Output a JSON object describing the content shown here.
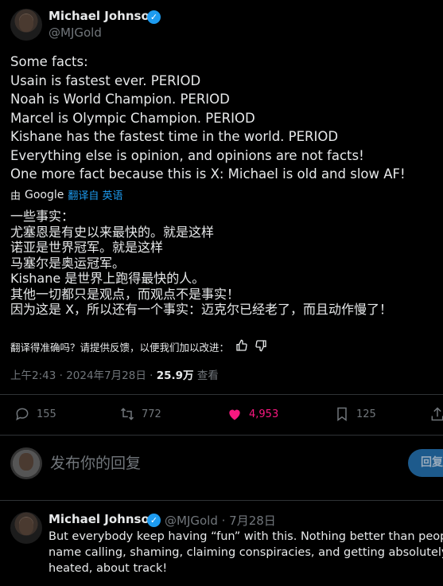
{
  "tweet": {
    "author_name": "Michael Johnson",
    "author_handle": "@MJGold",
    "lines": [
      "Some facts:",
      "Usain is fastest ever. PERIOD",
      "Noah is World Champion. PERIOD",
      "Marcel is Olympic Champion. PERIOD",
      "Kishane has the fastest time in the world. PERIOD",
      "Everything else is opinion, and opinions are not facts!",
      "One more fact because this is X: Michael is old and slow AF!"
    ],
    "translated_by": "由",
    "translated_provider": "Google",
    "translated_from": "翻译自 英语",
    "translation_lines": [
      "一些事实：",
      "尤塞恩是有史以来最快的。就是这样",
      "诺亚是世界冠军。就是这样",
      "马塞尔是奥运冠军。",
      "Kishane 是世界上跑得最快的人。",
      "其他一切都只是观点，而观点不是事实！",
      "因为这是 X，所以还有一个事实：迈克尔已经老了，而且动作慢了！"
    ],
    "feedback_prompt": "翻译得准确吗？请提供反馈，以便我们加以改进：",
    "timestamp": "上午2:43 · 2024年7月28日 ·",
    "views": "25.9万",
    "views_label": "查看",
    "counts": {
      "replies": "155",
      "reposts": "772",
      "likes": "4,953",
      "bookmarks": "125"
    }
  },
  "reply_box": {
    "placeholder": "发布你的回复",
    "button_label": "回复"
  },
  "reply": {
    "author_name": "Michael Johnson",
    "author_handle": "@MJGold",
    "date": "· 7月28日",
    "lines": [
      "But everybody keep having “fun” with this. Nothing better than people",
      "name calling, shaming, claiming conspiracies, and getting absolutely",
      "heated, about track!"
    ]
  },
  "colors": {
    "accent": "#1d9bf0",
    "like": "#f91880",
    "muted": "#71767b",
    "text": "#e7e9ea",
    "background": "#000000"
  }
}
